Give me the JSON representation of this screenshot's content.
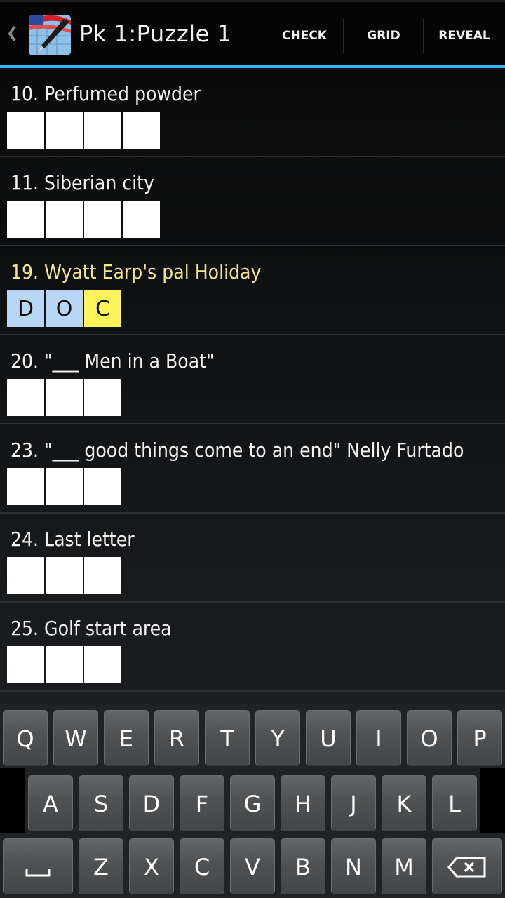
{
  "actionbar": {
    "title": "Pk 1:Puzzle 1",
    "actions": [
      {
        "label": "CHECK"
      },
      {
        "label": "GRID"
      },
      {
        "label": "REVEAL"
      }
    ],
    "accent_color": "#33b5e5"
  },
  "clues": [
    {
      "text": "10. Perfumed powder",
      "cells": [
        "",
        "",
        "",
        ""
      ],
      "active": false
    },
    {
      "text": "11. Siberian city",
      "cells": [
        "",
        "",
        "",
        ""
      ],
      "active": false
    },
    {
      "text": "19. Wyatt Earp's pal Holiday",
      "cells": [
        "D",
        "O",
        "C"
      ],
      "active": true,
      "cursor_index": 2
    },
    {
      "text": "20. \"___ Men in a Boat\"",
      "cells": [
        "",
        "",
        ""
      ],
      "active": false
    },
    {
      "text": "23. \"___ good things come to an end\" Nelly Furtado",
      "cells": [
        "",
        "",
        ""
      ],
      "active": false
    },
    {
      "text": "24. Last letter",
      "cells": [
        "",
        "",
        ""
      ],
      "active": false
    },
    {
      "text": "25. Golf start area",
      "cells": [
        "",
        "",
        ""
      ],
      "active": false
    }
  ],
  "colors": {
    "active_clue_text": "#f4e68a",
    "word_highlight": "#b9d6f7",
    "cursor_cell": "#fff35c"
  },
  "keyboard": {
    "row1": [
      "Q",
      "W",
      "E",
      "R",
      "T",
      "Y",
      "U",
      "I",
      "O",
      "P"
    ],
    "row2": [
      "A",
      "S",
      "D",
      "F",
      "G",
      "H",
      "J",
      "K",
      "L"
    ],
    "row3": [
      "Z",
      "X",
      "C",
      "V",
      "B",
      "N",
      "M"
    ],
    "space_icon": "space-bar-icon",
    "backspace_icon": "backspace-icon"
  }
}
